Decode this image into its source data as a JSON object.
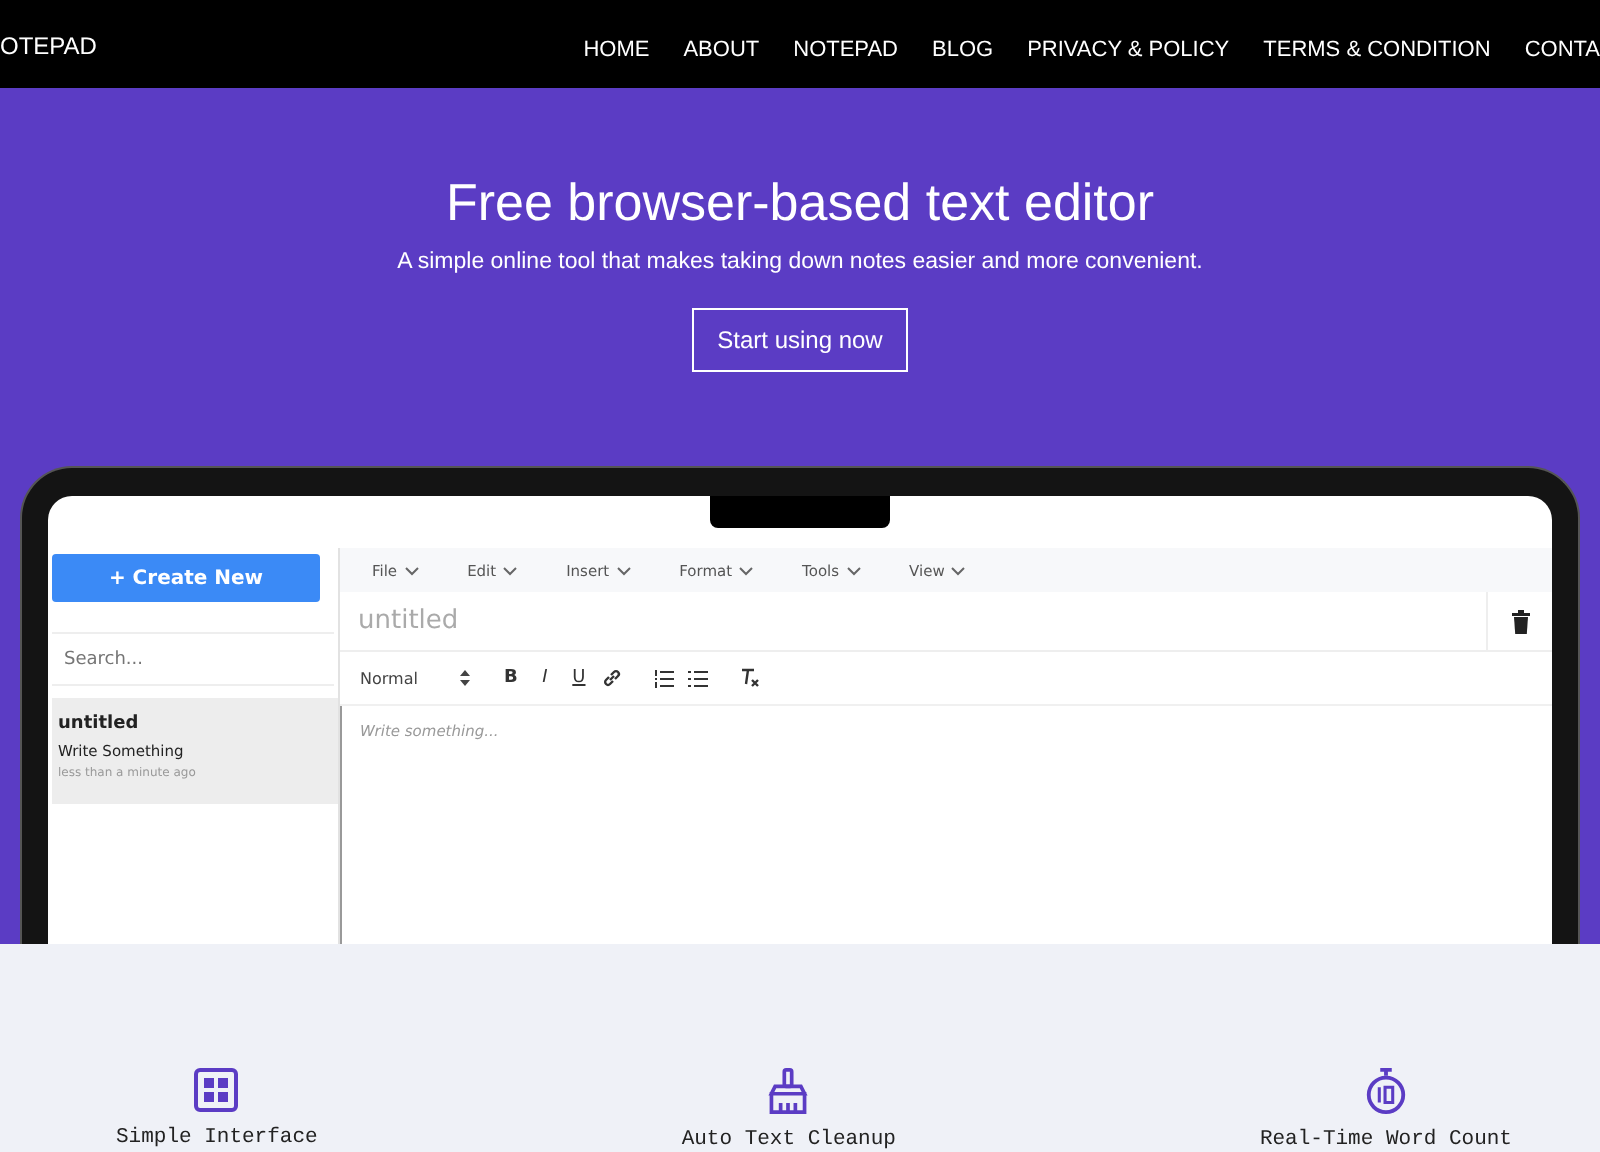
{
  "nav": {
    "logo": "OTEPAD",
    "links": [
      {
        "label": "HOME"
      },
      {
        "label": "ABOUT"
      },
      {
        "label": "NOTEPAD"
      },
      {
        "label": "BLOG"
      },
      {
        "label": "PRIVACY & POLICY"
      },
      {
        "label": "TERMS & CONDITION"
      },
      {
        "label": "CONTA"
      }
    ]
  },
  "hero": {
    "title": "Free browser-based text editor",
    "subtitle": "A simple online tool that makes taking down notes easier and more convenient.",
    "button": "Start using now"
  },
  "app": {
    "create_button": "+ Create New",
    "search": {
      "placeholder": "Search..."
    },
    "notes": [
      {
        "title": "untitled",
        "preview": "Write Something",
        "time": "less than a minute ago",
        "selected": true
      }
    ],
    "menu": [
      {
        "label": "File"
      },
      {
        "label": "Edit"
      },
      {
        "label": "Insert"
      },
      {
        "label": "Format"
      },
      {
        "label": "Tools"
      },
      {
        "label": "View"
      }
    ],
    "note_title": {
      "placeholder": "untitled"
    },
    "toolbar": {
      "style_select": "Normal",
      "tools": [
        {
          "kind": "bold",
          "label": "B"
        },
        {
          "kind": "italic",
          "label": "I"
        },
        {
          "kind": "underline",
          "label": "U"
        },
        {
          "kind": "link"
        },
        {
          "kind": "ordered-list"
        },
        {
          "kind": "bullet-list"
        },
        {
          "kind": "clear-format"
        }
      ]
    },
    "editor": {
      "placeholder": "Write something..."
    }
  },
  "features": [
    {
      "kind": "grid",
      "label": "Simple Interface"
    },
    {
      "kind": "broom",
      "label": "Auto Text Cleanup"
    },
    {
      "kind": "timer",
      "label": "Real-Time Word Count"
    }
  ]
}
